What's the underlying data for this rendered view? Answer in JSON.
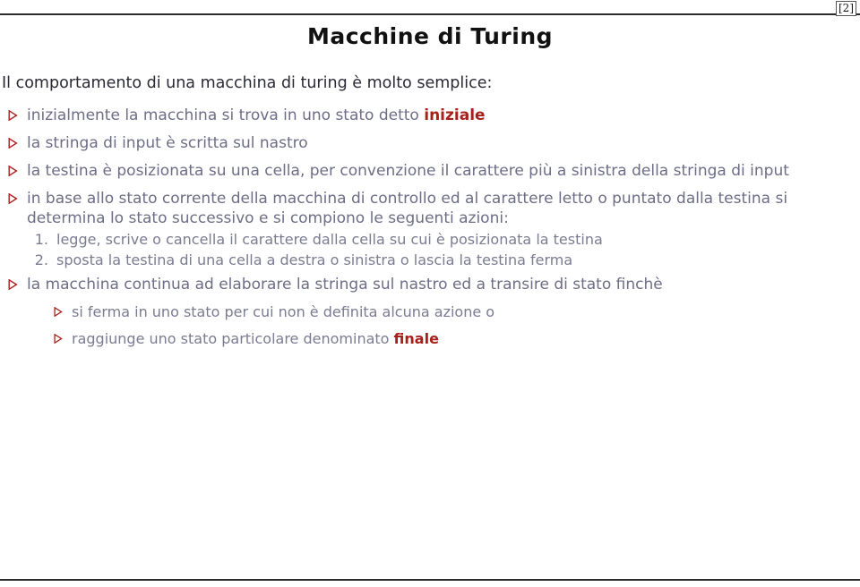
{
  "page": {
    "number_label": "[2]",
    "accent_red": "#a8201c",
    "body_text_color": "#6d6d87",
    "title_color": "#111111",
    "rule_color": "#2b2b2b"
  },
  "title": "Macchine di Turing",
  "intro": "Il comportamento di una macchina di turing è molto semplice:",
  "bullets": [
    {
      "marker": "triangle-right-icon",
      "text_before": "inizialmente la macchina si trova in uno stato detto ",
      "emphasis": "iniziale",
      "text_after": ""
    },
    {
      "marker": "triangle-right-icon",
      "text_before": "la stringa di input è scritta sul nastro",
      "emphasis": "",
      "text_after": ""
    },
    {
      "marker": "triangle-right-icon",
      "text_before": "la testina è posizionata su una cella, per convenzione il carattere più a sinistra della stringa di input",
      "emphasis": "",
      "text_after": ""
    },
    {
      "marker": "triangle-right-icon",
      "text_before": "in base allo stato corrente della macchina di controllo ed al carattere letto o puntato dalla testina si determina lo stato successivo e si compiono le seguenti azioni:",
      "emphasis": "",
      "text_after": ""
    }
  ],
  "enumerated": [
    {
      "number": "1.",
      "text": "legge, scrive o cancella il carattere dalla cella su cui è posizionata la testina"
    },
    {
      "number": "2.",
      "text": "sposta la testina di una cella a destra o sinistra o lascia la testina ferma"
    }
  ],
  "final_bullet": {
    "marker": "triangle-right-icon",
    "text": "la macchina continua ad elaborare la stringa sul nastro ed a transire di stato finchè"
  },
  "sub_bullets": [
    {
      "marker": "triangle-right-icon",
      "text_before": "si ferma in uno stato per cui non è definita alcuna azione o",
      "emphasis": "",
      "text_after": ""
    },
    {
      "marker": "triangle-right-icon",
      "text_before": "raggiunge uno stato particolare denominato ",
      "emphasis": "finale",
      "text_after": ""
    }
  ]
}
